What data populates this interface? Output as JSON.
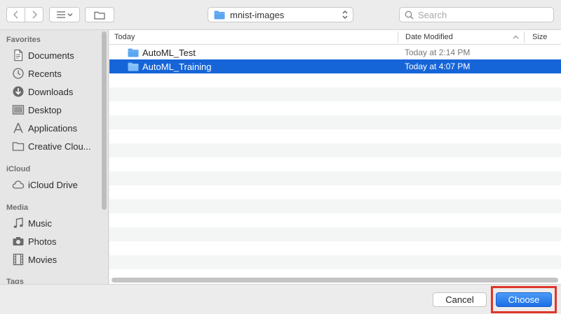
{
  "toolbar": {
    "path_label": "mnist-images",
    "search_placeholder": "Search"
  },
  "sidebar": {
    "sections": {
      "favorites": "Favorites",
      "icloud": "iCloud",
      "media": "Media",
      "tags": "Tags"
    },
    "favorites": [
      {
        "label": "Documents",
        "icon": "documents-icon"
      },
      {
        "label": "Recents",
        "icon": "recents-icon"
      },
      {
        "label": "Downloads",
        "icon": "downloads-icon"
      },
      {
        "label": "Desktop",
        "icon": "desktop-icon"
      },
      {
        "label": "Applications",
        "icon": "applications-icon"
      },
      {
        "label": "Creative Clou...",
        "icon": "folder-icon"
      }
    ],
    "icloud": [
      {
        "label": "iCloud Drive",
        "icon": "cloud-icon"
      }
    ],
    "media": [
      {
        "label": "Music",
        "icon": "music-icon"
      },
      {
        "label": "Photos",
        "icon": "camera-icon"
      },
      {
        "label": "Movies",
        "icon": "film-icon"
      }
    ]
  },
  "columns": {
    "name": "Today",
    "date": "Date Modified",
    "size": "Size"
  },
  "files": [
    {
      "name": "AutoML_Test",
      "date": "Today at 2:14 PM",
      "selected": false
    },
    {
      "name": "AutoML_Training",
      "date": "Today at 4:07 PM",
      "selected": true
    }
  ],
  "buttons": {
    "cancel": "Cancel",
    "choose": "Choose"
  },
  "colors": {
    "selection": "#1665d8",
    "highlight_box": "#e0352b",
    "folder": "#5aa6f0"
  }
}
